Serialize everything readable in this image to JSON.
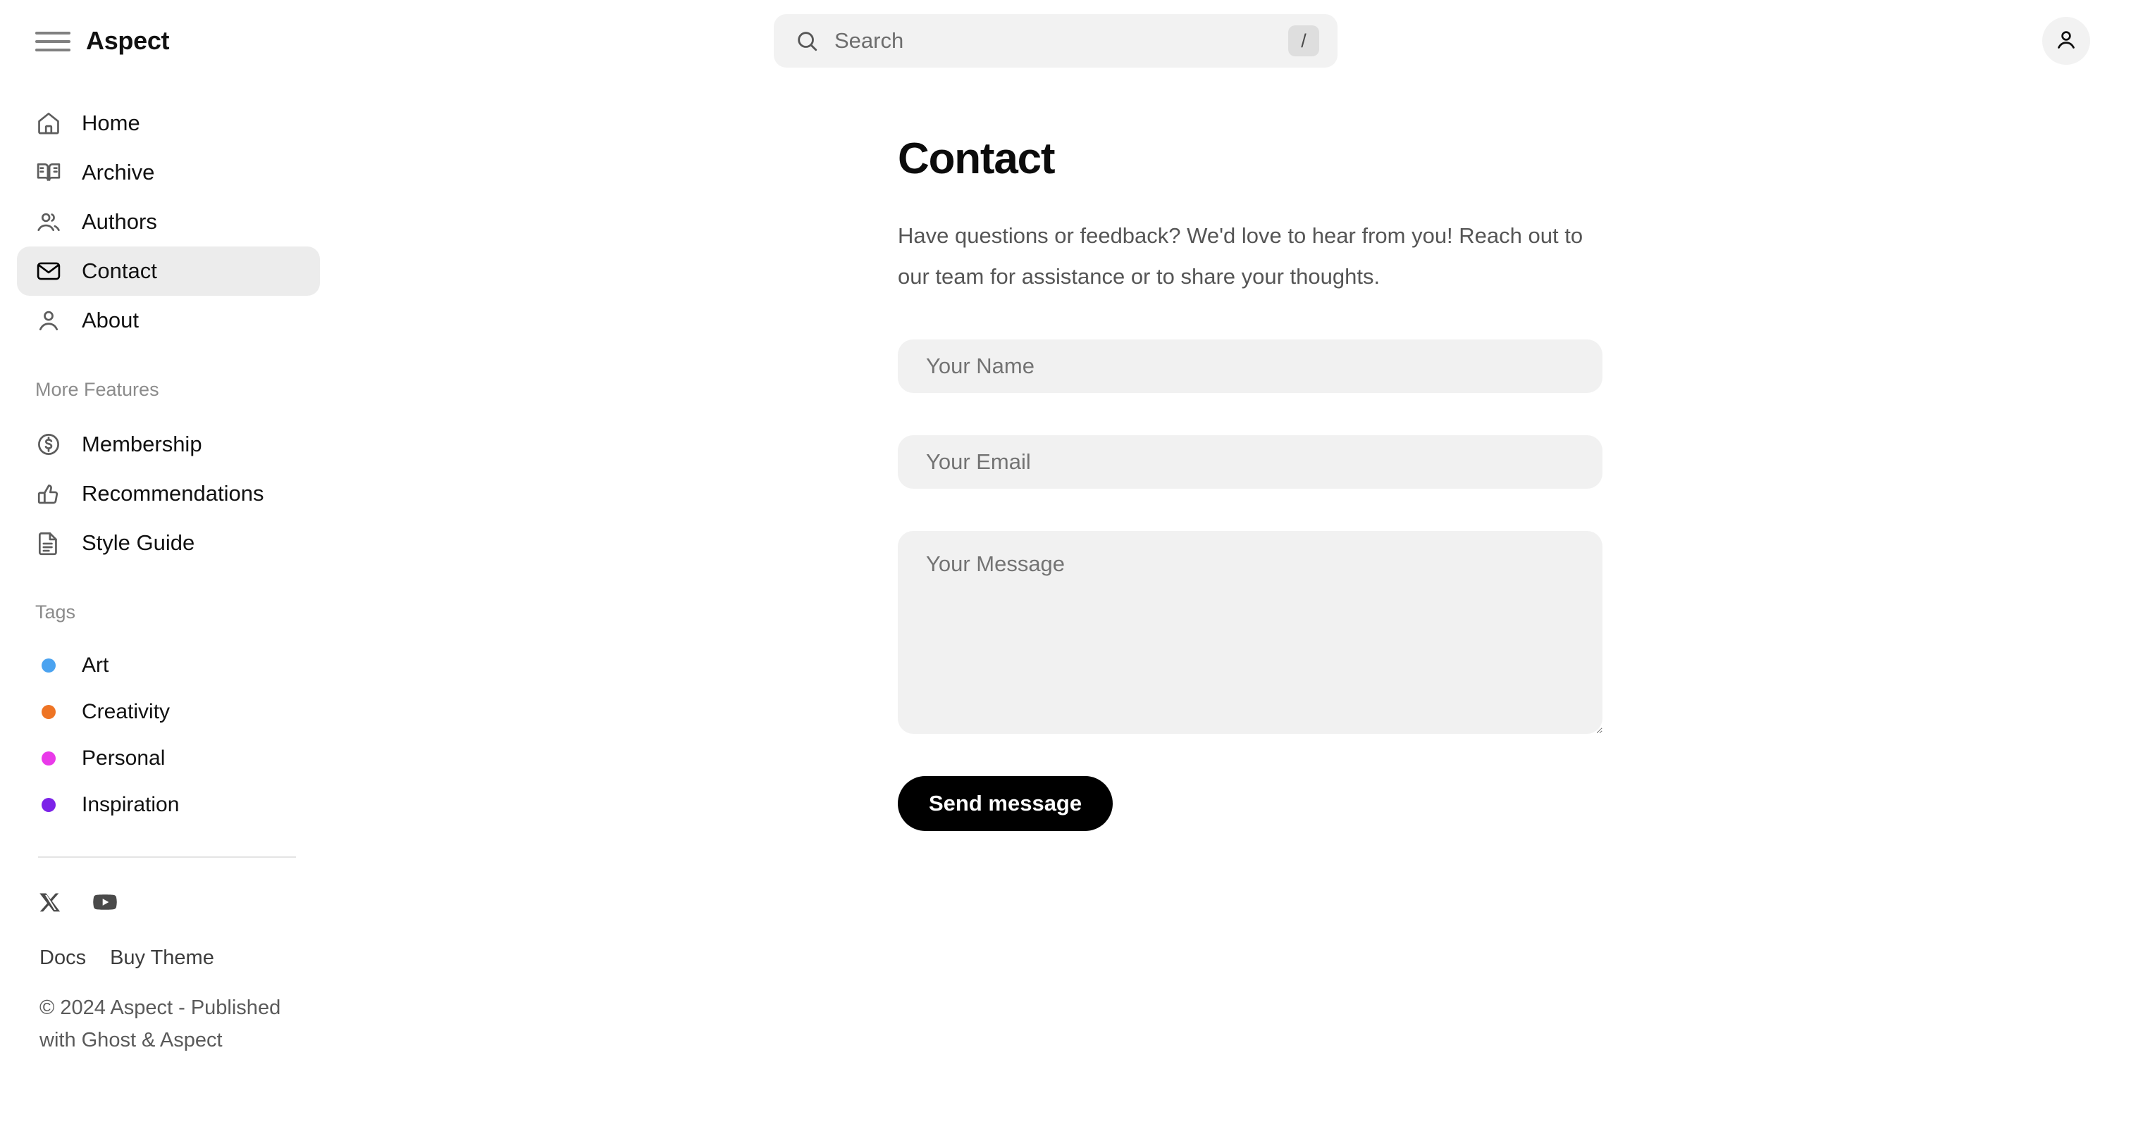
{
  "header": {
    "menu_icon": "hamburger-icon",
    "brand": "Aspect",
    "search": {
      "icon": "search-icon",
      "placeholder": "Search",
      "shortcut": "/"
    },
    "account_icon": "user-icon"
  },
  "sidebar": {
    "primary_nav": [
      {
        "label": "Home",
        "icon": "home-icon",
        "active": false
      },
      {
        "label": "Archive",
        "icon": "book-icon",
        "active": false
      },
      {
        "label": "Authors",
        "icon": "users-icon",
        "active": false
      },
      {
        "label": "Contact",
        "icon": "mail-icon",
        "active": true
      },
      {
        "label": "About",
        "icon": "user-icon",
        "active": false
      }
    ],
    "more_features_heading": "More Features",
    "more_features": [
      {
        "label": "Membership",
        "icon": "dollar-circle-icon"
      },
      {
        "label": "Recommendations",
        "icon": "thumbs-up-icon"
      },
      {
        "label": "Style Guide",
        "icon": "document-icon"
      }
    ],
    "tags_heading": "Tags",
    "tags": [
      {
        "label": "Art",
        "color": "#4ba3f0"
      },
      {
        "label": "Creativity",
        "color": "#ee7424"
      },
      {
        "label": "Personal",
        "color": "#e93ae9"
      },
      {
        "label": "Inspiration",
        "color": "#7c23e8"
      }
    ],
    "social": [
      {
        "name": "x-icon",
        "label": "X"
      },
      {
        "name": "youtube-icon",
        "label": "YouTube"
      }
    ],
    "footer_links": [
      {
        "label": "Docs"
      },
      {
        "label": "Buy Theme"
      }
    ],
    "copyright": "© 2024 Aspect - Published with Ghost & Aspect"
  },
  "main": {
    "title": "Contact",
    "description": "Have questions or feedback? We'd love to hear from you! Reach out to our team for assistance or to share your thoughts.",
    "form": {
      "name_placeholder": "Your Name",
      "name_value": "",
      "email_placeholder": "Your Email",
      "email_value": "",
      "message_placeholder": "Your Message",
      "message_value": "",
      "submit_label": "Send message"
    }
  },
  "colors": {
    "accent": "#000000",
    "field_bg": "#f1f1f1",
    "active_nav_bg": "#ececec"
  }
}
